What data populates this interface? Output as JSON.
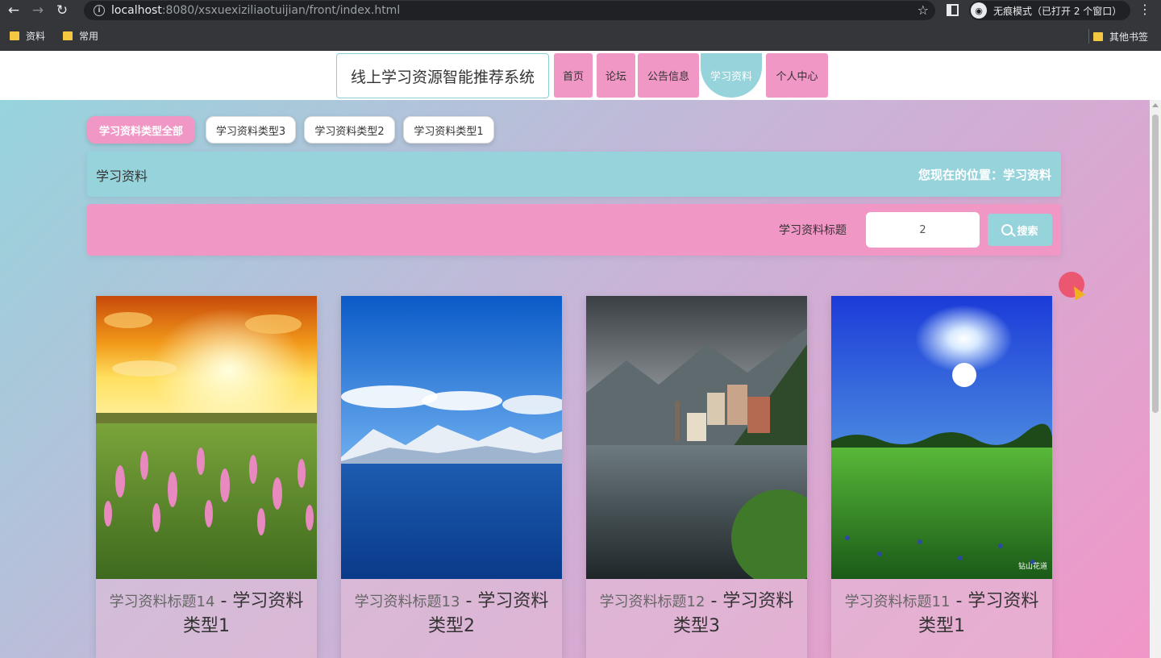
{
  "browser": {
    "url_host": "localhost",
    "url_rest": ":8080/xsxuexiziliaotuijian/front/index.html",
    "incognito_label": "无痕模式（已打开 2 个窗口）",
    "bookmarks": [
      "资料",
      "常用"
    ],
    "other_bookmarks": "其他书签"
  },
  "header": {
    "site_title": "线上学习资源智能推荐系统",
    "nav": [
      {
        "label": "首页"
      },
      {
        "label": "论坛"
      },
      {
        "label": "公告信息"
      },
      {
        "label": "学习资料"
      },
      {
        "label": "个人中心"
      }
    ],
    "active_nav": "学习资料"
  },
  "types": [
    "学习资料类型全部",
    "学习资料类型3",
    "学习资料类型2",
    "学习资料类型1"
  ],
  "breadcrumb": {
    "title": "学习资料",
    "position": "您现在的位置：学习资料"
  },
  "search": {
    "label": "学习资料标题",
    "value": "2",
    "button_label": "搜索"
  },
  "cards": [
    {
      "title": "学习资料标题14",
      "dash": " - ",
      "type": "学习资料类型1",
      "image": "sunset-flower-field"
    },
    {
      "title": "学习资料标题13",
      "dash": " - ",
      "type": "学习资料类型2",
      "image": "snow-mountain-lake"
    },
    {
      "title": "学习资料标题12",
      "dash": " - ",
      "type": "学习资料类型3",
      "image": "alpine-village-lake"
    },
    {
      "title": "学习资料标题11",
      "dash": " - ",
      "type": "学习资料类型1",
      "image": "moonlit-meadow"
    }
  ],
  "watermark": "钻山花道",
  "colors": {
    "pink": "#f097c6",
    "teal": "#96d3db"
  }
}
